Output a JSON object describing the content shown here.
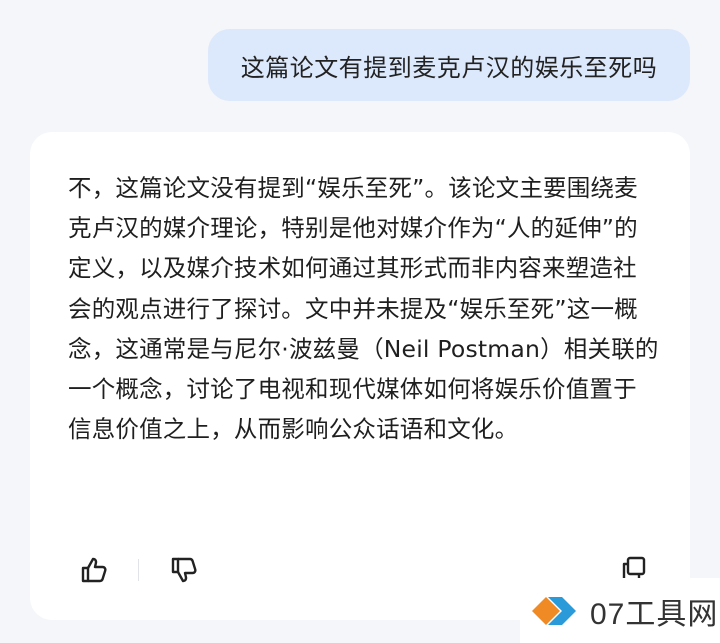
{
  "conversation": {
    "user_message": "这篇论文有提到麦克卢汉的娱乐至死吗",
    "assistant_message": "不，这篇论文没有提到“娱乐至死”。该论文主要围绕麦克卢汉的媒介理论，特别是他对媒介作为“人的延伸”的定义，以及媒介技术如何通过其形式而非内容来塑造社会的观点进行了探讨。文中并未提及“娱乐至死”这一概念，这通常是与尼尔·波兹曼（Neil Postman）相关联的一个概念，讨论了电视和现代媒体如何将娱乐价值置于信息价值之上，从而影响公众话语和文化。"
  },
  "actions": {
    "like_icon": "thumbs-up-icon",
    "dislike_icon": "thumbs-down-icon",
    "copy_icon": "copy-icon"
  },
  "watermark": {
    "text": "07工具网",
    "colors": {
      "orange": "#f08a24",
      "blue": "#2a9bd8"
    }
  },
  "colors": {
    "background": "#f4f6fa",
    "user_bubble": "#dce8fb",
    "card": "#ffffff",
    "text": "#1f1f1f"
  }
}
